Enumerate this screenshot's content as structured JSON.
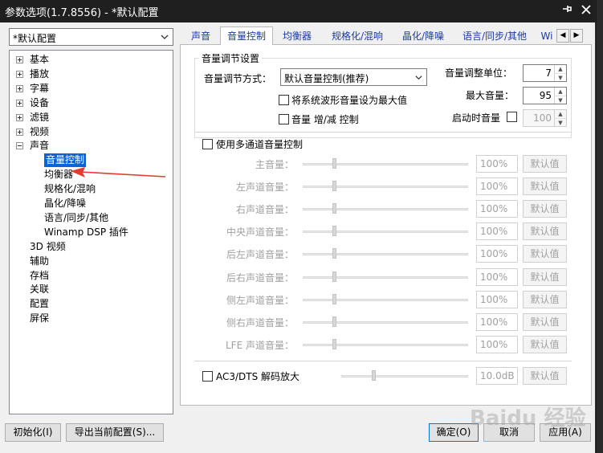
{
  "window": {
    "title": "参数选项(1.7.8556) - *默认配置"
  },
  "profile": {
    "selected": "*默认配置"
  },
  "tree": {
    "items": [
      {
        "label": "基本",
        "expander": "plus"
      },
      {
        "label": "播放",
        "expander": "plus"
      },
      {
        "label": "字幕",
        "expander": "plus"
      },
      {
        "label": "设备",
        "expander": "plus"
      },
      {
        "label": "滤镜",
        "expander": "plus"
      },
      {
        "label": "视频",
        "expander": "plus"
      },
      {
        "label": "声音",
        "expander": "minus"
      },
      {
        "label": "音量控制",
        "selected": true
      },
      {
        "label": "均衡器"
      },
      {
        "label": "规格化/混响"
      },
      {
        "label": "晶化/降噪"
      },
      {
        "label": "语言/同步/其他"
      },
      {
        "label": "Winamp DSP 插件"
      },
      {
        "label": "3D 视频"
      },
      {
        "label": "辅助"
      },
      {
        "label": "存档"
      },
      {
        "label": "关联"
      },
      {
        "label": "配置"
      },
      {
        "label": "屏保"
      }
    ]
  },
  "tabs": [
    "声音",
    "音量控制",
    "均衡器",
    "规格化/混响",
    "晶化/降噪",
    "语言/同步/其他",
    "Wi"
  ],
  "volume_settings": {
    "group_title": "音量调节设置",
    "method_label": "音量调节方式：",
    "method_value": "默认音量控制(推荐)",
    "waveform_max_label": "将系统波形音量设为最大值",
    "volume_incdec_label": "音量 增/减 控制",
    "step_label": "音量调整单位：",
    "step_value": "7",
    "max_label": "最大音量：",
    "max_value": "95",
    "startup_label": "启动时音量",
    "startup_value": "100"
  },
  "multichannel": {
    "label": "使用多通道音量控制",
    "channels": [
      {
        "label": "主音量：",
        "value": "100%",
        "default": "默认值"
      },
      {
        "label": "左声道音量：",
        "value": "100%",
        "default": "默认值"
      },
      {
        "label": "右声道音量：",
        "value": "100%",
        "default": "默认值"
      },
      {
        "label": "中央声道音量：",
        "value": "100%",
        "default": "默认值"
      },
      {
        "label": "后左声道音量：",
        "value": "100%",
        "default": "默认值"
      },
      {
        "label": "后右声道音量：",
        "value": "100%",
        "default": "默认值"
      },
      {
        "label": "侧左声道音量：",
        "value": "100%",
        "default": "默认值"
      },
      {
        "label": "侧右声道音量：",
        "value": "100%",
        "default": "默认值"
      },
      {
        "label": "LFE 声道音量：",
        "value": "100%",
        "default": "默认值"
      }
    ]
  },
  "ac3": {
    "label": "AC3/DTS 解码放大",
    "value": "10.0dB",
    "default": "默认值"
  },
  "buttons": {
    "init": "初始化(I)",
    "export": "导出当前配置(S)...",
    "ok": "确定(O)",
    "cancel": "取消",
    "apply": "应用(A)"
  },
  "watermark": "Baidu 经验"
}
